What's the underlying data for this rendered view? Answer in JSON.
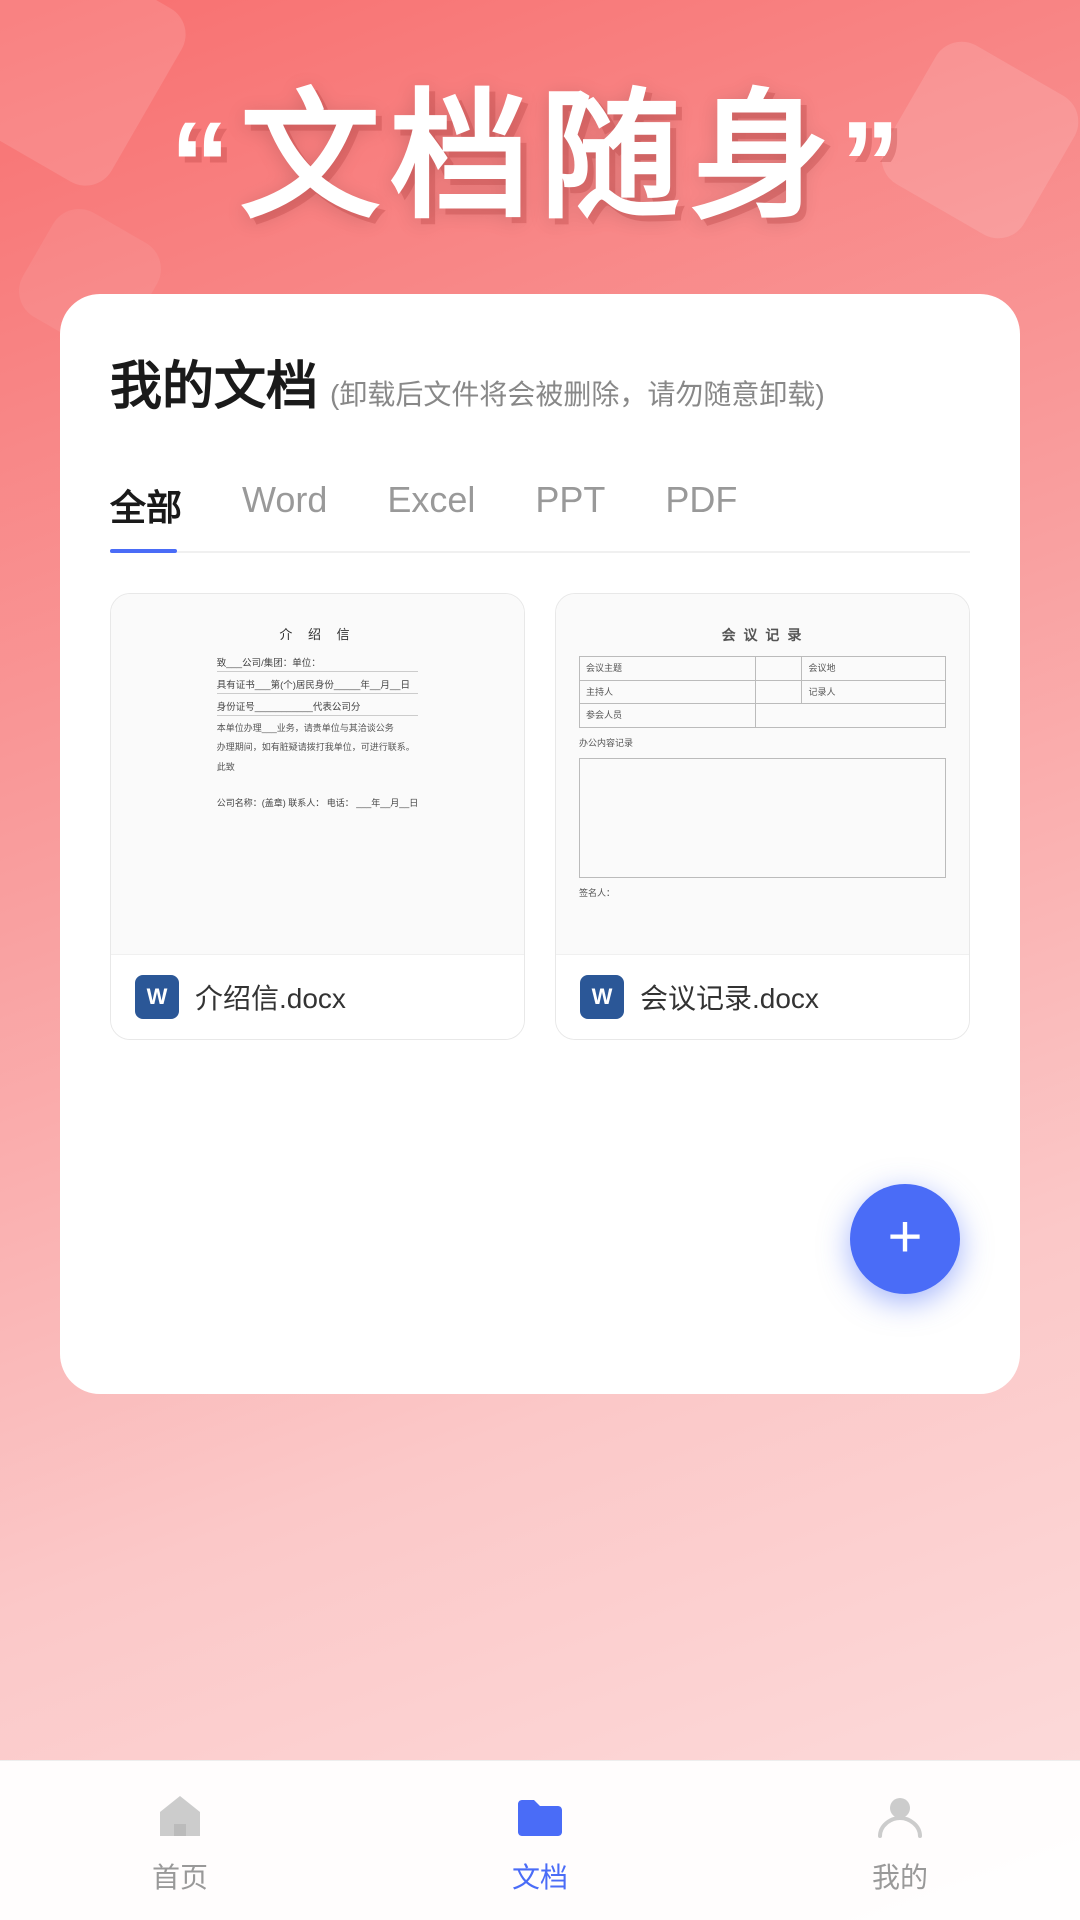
{
  "hero": {
    "quote_open": "“",
    "quote_close": "”",
    "title": "文档随身"
  },
  "card": {
    "title": "我的文档",
    "subtitle": "(卸载后文件将会被删除，请勿随意卸载)"
  },
  "tabs": [
    {
      "id": "all",
      "label": "全部",
      "active": true
    },
    {
      "id": "word",
      "label": "Word",
      "active": false
    },
    {
      "id": "excel",
      "label": "Excel",
      "active": false
    },
    {
      "id": "ppt",
      "label": "PPT",
      "active": false
    },
    {
      "id": "pdf",
      "label": "PDF",
      "active": false
    }
  ],
  "documents": [
    {
      "id": "doc1",
      "name": "介绍信.docx",
      "type": "word",
      "preview_title": "介 绍 信",
      "preview_lines": [
        "致___公司/集团：单位：",
        "具有证书___第(个)居民身份_____年__月__日",
        "身份证号___________代表公司分",
        "本单位办理___业务，请贵单位与其洽谈公务",
        "办理期间，如有脏疑请拨打我单位，可进行联系。"
      ],
      "preview_closing": "此致",
      "preview_signature": "公司名称：(盖章)\n联系人：\n电话：\n___年__月__日"
    },
    {
      "id": "doc2",
      "name": "会议记录.docx",
      "type": "word",
      "preview_title": "会 议 记 录",
      "table_rows": [
        [
          "会议主题",
          "",
          "会议地"
        ],
        [
          "主持人",
          "",
          "记录人"
        ],
        [
          "参会人员",
          ""
        ]
      ],
      "box_label": "办公内容记录",
      "signer_label": "签名人："
    }
  ],
  "fab": {
    "label": "+"
  },
  "bottom_nav": [
    {
      "id": "home",
      "label": "首页",
      "active": false,
      "icon": "home"
    },
    {
      "id": "docs",
      "label": "文档",
      "active": true,
      "icon": "folder"
    },
    {
      "id": "profile",
      "label": "我的",
      "active": false,
      "icon": "user"
    }
  ],
  "colors": {
    "accent": "#4a6cf7",
    "word_blue": "#2b5797",
    "bg_gradient_start": "#f87070",
    "bg_gradient_end": "#fddede"
  }
}
